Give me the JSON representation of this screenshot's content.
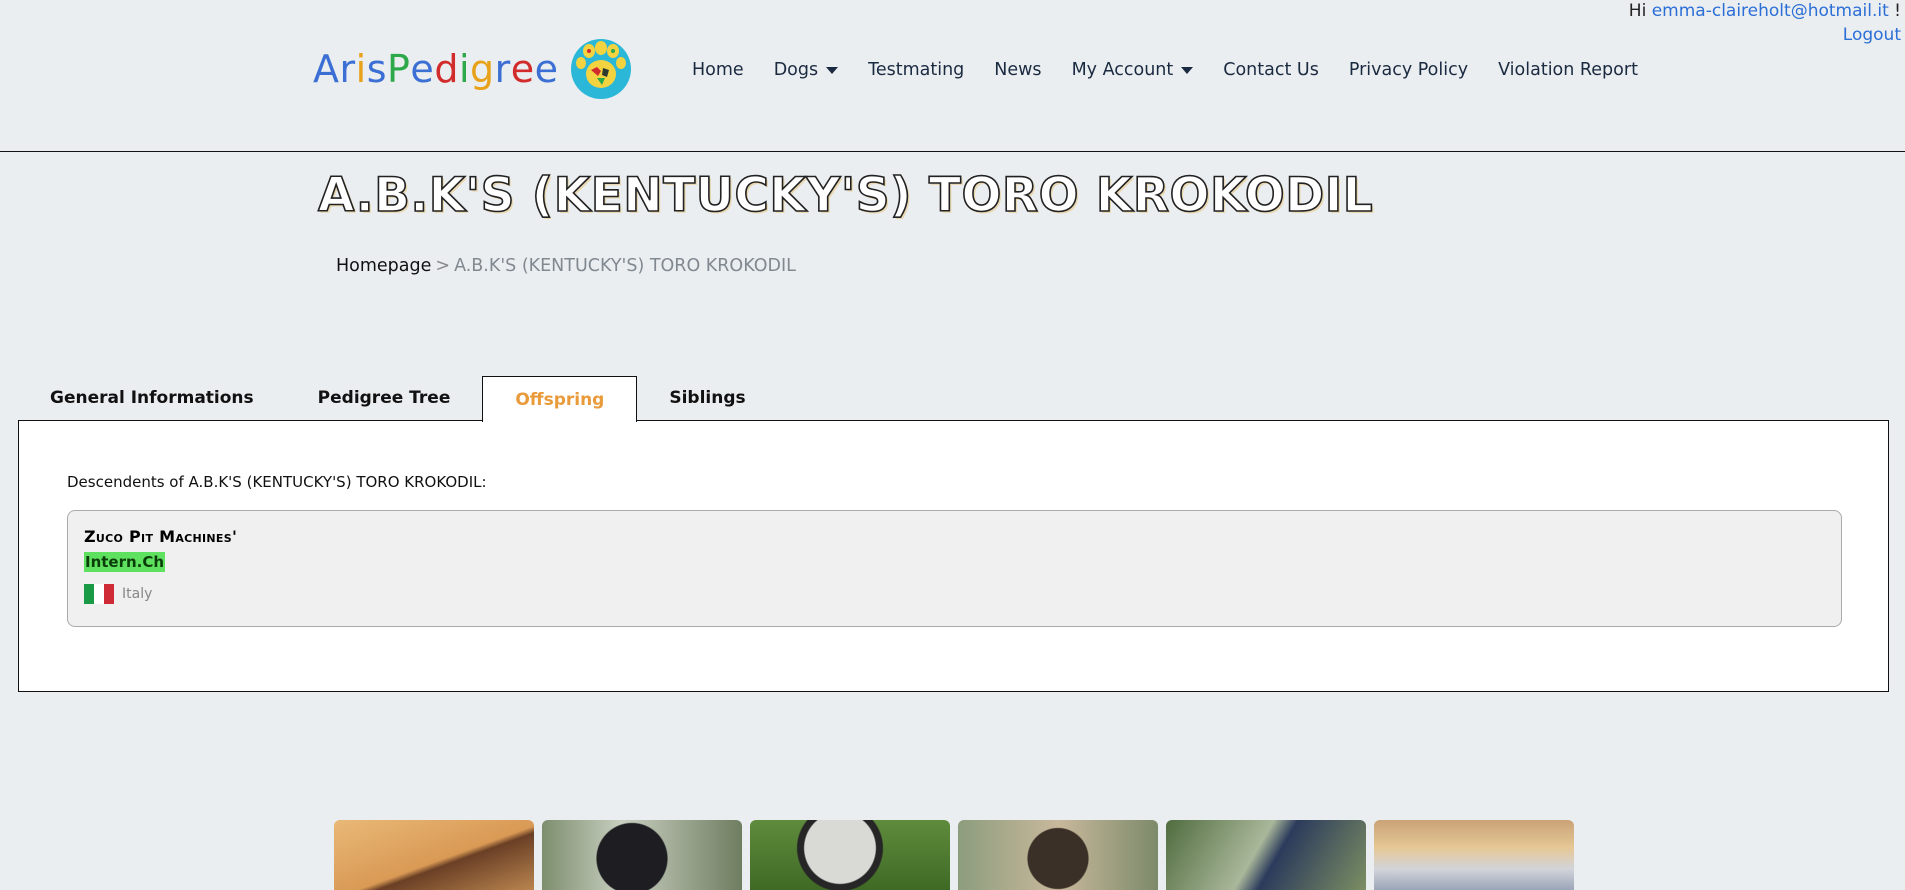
{
  "user": {
    "greeting": "Hi",
    "email": "emma-claireholt@hotmail.it",
    "exclaim": "!",
    "logout_label": "Logout"
  },
  "logo": {
    "letters": [
      "A",
      "r",
      "i",
      "s",
      "P",
      "e",
      "d",
      "i",
      "g",
      "r",
      "e",
      "e"
    ],
    "letter_colors": [
      "#3b6fd4",
      "#3b6fd4",
      "#e8a21a",
      "#3b6fd4",
      "#2da84a",
      "#3b6fd4",
      "#d12b2b",
      "#2da84a",
      "#e8a21a",
      "#3b6fd4",
      "#d12b2b",
      "#3b6fd4"
    ],
    "paw_icon": "paw-world-map-icon"
  },
  "nav": {
    "items": [
      {
        "label": "Home",
        "dropdown": false
      },
      {
        "label": "Dogs",
        "dropdown": true
      },
      {
        "label": "Testmating",
        "dropdown": false
      },
      {
        "label": "News",
        "dropdown": false
      },
      {
        "label": "My Account",
        "dropdown": true
      },
      {
        "label": "Contact Us",
        "dropdown": false
      },
      {
        "label": "Privacy Policy",
        "dropdown": false
      },
      {
        "label": "Violation Report",
        "dropdown": false
      }
    ]
  },
  "page": {
    "title": "A.B.K'S (KENTUCKY'S) TORO KROKODIL",
    "breadcrumb": {
      "home": "Homepage",
      "separator": ">",
      "current": "A.B.K'S (KENTUCKY'S) TORO KROKODIL"
    }
  },
  "tabs": [
    {
      "label": "General Informations",
      "active": false
    },
    {
      "label": "Pedigree Tree",
      "active": false
    },
    {
      "label": "Offspring",
      "active": true
    },
    {
      "label": "Siblings",
      "active": false
    }
  ],
  "offspring": {
    "heading": "Descendents of A.B.K'S (KENTUCKY'S) TORO KROKODIL:",
    "items": [
      {
        "name": "Zuco Pit Machines'",
        "title": "Intern.Ch",
        "country": "Italy",
        "flag_colors": [
          "#1b9a45",
          "#ffffff",
          "#ce2b37"
        ]
      }
    ]
  },
  "colors": {
    "background": "#ebeef1",
    "active_tab": "#e99a3a",
    "link": "#2b6fd6",
    "title_badge": "#5ee15e"
  },
  "thumbnails": [
    "dog-photo-brown",
    "dog-photo-black-cane-corso",
    "dog-photo-helmet",
    "dog-photo-brindle",
    "dog-photo-training",
    "dog-photo-show-hall"
  ]
}
